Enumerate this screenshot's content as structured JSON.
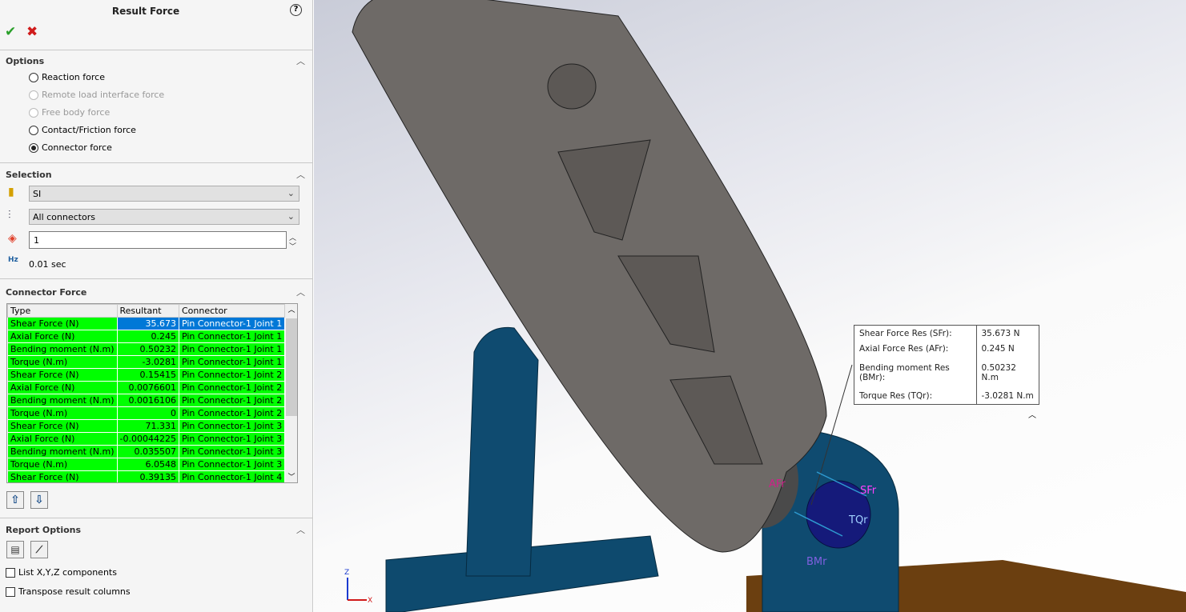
{
  "panel": {
    "title": "Result Force",
    "help_icon": "help-icon",
    "ok_icon": "check-icon",
    "cancel_icon": "close-icon"
  },
  "options": {
    "header": "Options",
    "radios": [
      {
        "label": "Reaction force",
        "enabled": true,
        "checked": false
      },
      {
        "label": "Remote load interface force",
        "enabled": false,
        "checked": false
      },
      {
        "label": "Free body force",
        "enabled": false,
        "checked": false
      },
      {
        "label": "Contact/Friction force",
        "enabled": true,
        "checked": false
      },
      {
        "label": "Connector force",
        "enabled": true,
        "checked": true
      }
    ]
  },
  "selection": {
    "header": "Selection",
    "units": "SI",
    "connectors": "All connectors",
    "step": "1",
    "time": "0.01 sec"
  },
  "connector_force": {
    "header": "Connector Force",
    "columns": [
      "Type",
      "Resultant",
      "Connector"
    ],
    "rows": [
      [
        "Shear Force (N)",
        "35.673",
        "Pin Connector-1 Joint 1"
      ],
      [
        "Axial Force (N)",
        "0.245",
        "Pin Connector-1 Joint 1"
      ],
      [
        "Bending moment (N.m)",
        "0.50232",
        "Pin Connector-1 Joint 1"
      ],
      [
        "Torque (N.m)",
        "-3.0281",
        "Pin Connector-1 Joint 1"
      ],
      [
        "Shear Force (N)",
        "0.15415",
        "Pin Connector-1 Joint 2"
      ],
      [
        "Axial Force (N)",
        "0.0076601",
        "Pin Connector-1 Joint 2"
      ],
      [
        "Bending moment (N.m)",
        "0.0016106",
        "Pin Connector-1 Joint 2"
      ],
      [
        "Torque (N.m)",
        "0",
        "Pin Connector-1 Joint 2"
      ],
      [
        "Shear Force (N)",
        "71.331",
        "Pin Connector-1 Joint 3"
      ],
      [
        "Axial Force (N)",
        "-0.00044225",
        "Pin Connector-1 Joint 3"
      ],
      [
        "Bending moment (N.m)",
        "0.035507",
        "Pin Connector-1 Joint 3"
      ],
      [
        "Torque (N.m)",
        "6.0548",
        "Pin Connector-1 Joint 3"
      ],
      [
        "Shear Force (N)",
        "0.39135",
        "Pin Connector-1 Joint 4"
      ]
    ],
    "row_color": "#00ff00",
    "selected_color": "#0078d7"
  },
  "report": {
    "header": "Report Options",
    "checkboxes": [
      {
        "label": "List X,Y,Z components",
        "checked": false
      },
      {
        "label": "Transpose result columns",
        "checked": false
      }
    ]
  },
  "callout": [
    [
      "Shear Force Res (SFr):",
      "35.673 N"
    ],
    [
      "Axial Force Res (AFr):",
      "0.245 N"
    ],
    [
      "Bending moment Res (BMr):",
      "0.50232 N.m"
    ],
    [
      "Torque Res (TQr):",
      "-3.0281 N.m"
    ]
  ],
  "labels": {
    "afr": "AFr",
    "sfr": "SFr",
    "tqr": "TQr",
    "bmr": "BMr",
    "axis_z": "Z",
    "axis_x": "X"
  }
}
